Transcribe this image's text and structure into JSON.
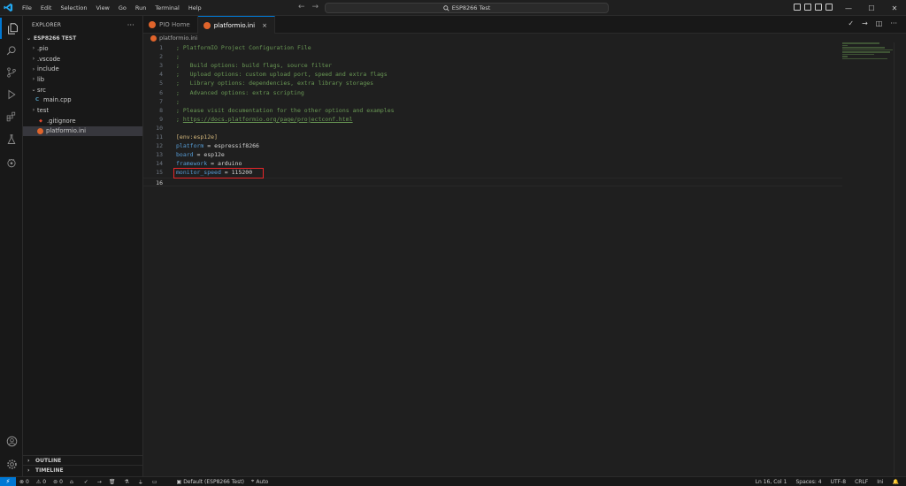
{
  "titlebar": {
    "menu": [
      "File",
      "Edit",
      "Selection",
      "View",
      "Go",
      "Run",
      "Terminal",
      "Help"
    ],
    "search": "ESP8266 Test"
  },
  "activity": {
    "items": [
      {
        "name": "explorer-icon",
        "active": true
      },
      {
        "name": "search-icon",
        "active": false
      },
      {
        "name": "source-control-icon",
        "active": false
      },
      {
        "name": "run-debug-icon",
        "active": false
      },
      {
        "name": "extensions-icon",
        "active": false
      },
      {
        "name": "testing-icon",
        "active": false
      },
      {
        "name": "platformio-icon",
        "active": false
      }
    ],
    "bottom": [
      "account-icon",
      "settings-gear-icon"
    ]
  },
  "sidebar": {
    "title": "EXPLORER",
    "project": "ESP8266 TEST",
    "tree": [
      {
        "label": ".pio",
        "type": "folder",
        "depth": 0,
        "expanded": false
      },
      {
        "label": ".vscode",
        "type": "folder",
        "depth": 0,
        "expanded": false
      },
      {
        "label": "include",
        "type": "folder",
        "depth": 0,
        "expanded": false
      },
      {
        "label": "lib",
        "type": "folder",
        "depth": 0,
        "expanded": false
      },
      {
        "label": "src",
        "type": "folder",
        "depth": 0,
        "expanded": true
      },
      {
        "label": "main.cpp",
        "type": "cpp",
        "depth": 1
      },
      {
        "label": "test",
        "type": "folder",
        "depth": 0,
        "expanded": false
      },
      {
        "label": ".gitignore",
        "type": "git",
        "depth": 0
      },
      {
        "label": "platformio.ini",
        "type": "pio",
        "depth": 0,
        "selected": true
      }
    ],
    "outline": "OUTLINE",
    "timeline": "TIMELINE"
  },
  "tabs": [
    {
      "label": "PIO Home",
      "active": false
    },
    {
      "label": "platformio.ini",
      "active": true,
      "close": "×"
    }
  ],
  "breadcrumb": "platformio.ini",
  "editor": {
    "lines": [
      {
        "n": "1",
        "tokens": [
          {
            "t": "; PlatformIO Project Configuration File",
            "c": "comment"
          }
        ]
      },
      {
        "n": "2",
        "tokens": [
          {
            "t": ";",
            "c": "comment"
          }
        ]
      },
      {
        "n": "3",
        "tokens": [
          {
            "t": ";   Build options: build flags, source filter",
            "c": "comment"
          }
        ]
      },
      {
        "n": "4",
        "tokens": [
          {
            "t": ";   Upload options: custom upload port, speed and extra flags",
            "c": "comment"
          }
        ]
      },
      {
        "n": "5",
        "tokens": [
          {
            "t": ";   Library options: dependencies, extra library storages",
            "c": "comment"
          }
        ]
      },
      {
        "n": "6",
        "tokens": [
          {
            "t": ";   Advanced options: extra scripting",
            "c": "comment"
          }
        ]
      },
      {
        "n": "7",
        "tokens": [
          {
            "t": ";",
            "c": "comment"
          }
        ]
      },
      {
        "n": "8",
        "tokens": [
          {
            "t": "; Please visit documentation for the other options and examples",
            "c": "comment"
          }
        ]
      },
      {
        "n": "9",
        "tokens": [
          {
            "t": "; ",
            "c": "comment"
          },
          {
            "t": "https://docs.platformio.org/page/projectconf.html",
            "c": "link"
          }
        ]
      },
      {
        "n": "10",
        "tokens": []
      },
      {
        "n": "11",
        "tokens": [
          {
            "t": "[env:esp12e]",
            "c": "section"
          }
        ]
      },
      {
        "n": "12",
        "tokens": [
          {
            "t": "platform",
            "c": "key"
          },
          {
            "t": " = ",
            "c": "eq"
          },
          {
            "t": "espressif8266",
            "c": "val"
          }
        ]
      },
      {
        "n": "13",
        "tokens": [
          {
            "t": "board",
            "c": "key"
          },
          {
            "t": " = ",
            "c": "eq"
          },
          {
            "t": "esp12e",
            "c": "val"
          }
        ]
      },
      {
        "n": "14",
        "tokens": [
          {
            "t": "framework",
            "c": "key"
          },
          {
            "t": " = ",
            "c": "eq"
          },
          {
            "t": "arduino",
            "c": "val"
          }
        ]
      },
      {
        "n": "15",
        "tokens": [
          {
            "t": "monitor_speed",
            "c": "key"
          },
          {
            "t": " = ",
            "c": "eq"
          },
          {
            "t": "115200",
            "c": "val"
          }
        ]
      },
      {
        "n": "16",
        "tokens": [],
        "current": true
      }
    ]
  },
  "status": {
    "left": [
      {
        "icon": "error-icon",
        "text": "0"
      },
      {
        "icon": "warning-icon",
        "text": "0"
      },
      {
        "icon": "notification-port-icon",
        "text": "0"
      },
      {
        "icon": "home-icon",
        "text": ""
      },
      {
        "icon": "build-check-icon",
        "text": "✓"
      },
      {
        "icon": "upload-arrow-icon",
        "text": "→"
      },
      {
        "icon": "clean-trash-icon",
        "text": ""
      },
      {
        "icon": "test-flask-icon",
        "text": ""
      },
      {
        "icon": "serial-plug-icon",
        "text": ""
      },
      {
        "icon": "terminal-icon",
        "text": ""
      },
      {
        "icon": "env-folder-icon",
        "text": "Default (ESP8266 Test)"
      },
      {
        "icon": "auto-port-icon",
        "text": "Auto"
      }
    ],
    "right": [
      "Ln 16, Col 1",
      "Spaces: 4",
      "UTF-8",
      "CRLF",
      "Ini"
    ]
  },
  "colors": {
    "accent": "#0078d4",
    "highlight_box": "#e8272a",
    "pio_orange": "#e0642b"
  }
}
